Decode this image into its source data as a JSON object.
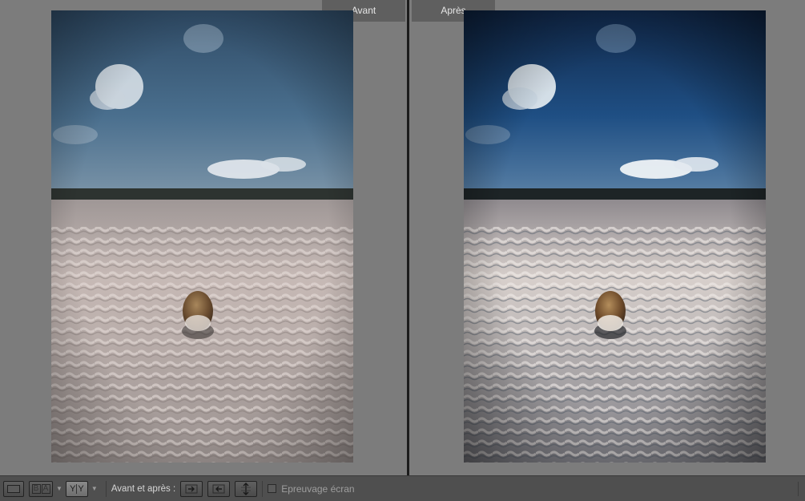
{
  "panes": {
    "before_label": "Avant",
    "after_label": "Après"
  },
  "toolbar": {
    "view_loupe_icon": "single-view-icon",
    "view_ba_icon": "side-by-side-ba-icon",
    "view_yy_icon": "split-yy-icon",
    "before_after_label": "Avant et après :",
    "copy_before_to_after_icon": "arrow-right-icon",
    "copy_after_to_before_icon": "arrow-left-icon",
    "swap_icon": "swap-arrows-icon",
    "soft_proofing_label": "Epreuvage écran",
    "soft_proofing_checked": false
  },
  "colors": {
    "stage_bg": "#7c7c7c",
    "toolbar_bg": "#4f4f4f",
    "label_bg": "#5f5f5f"
  }
}
